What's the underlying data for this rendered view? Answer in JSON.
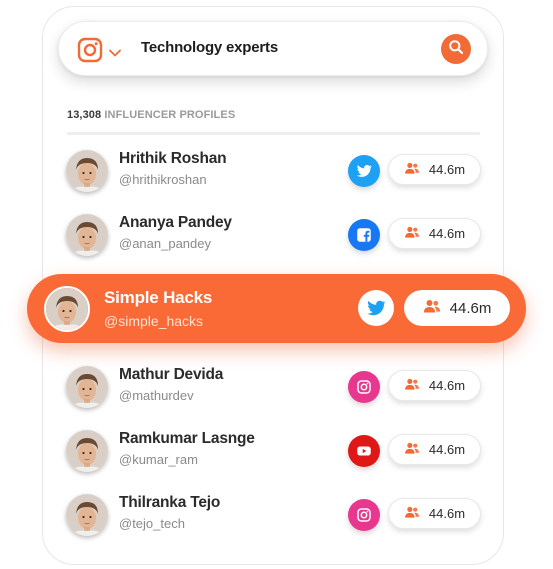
{
  "search": {
    "platform_icon": "instagram-icon",
    "query": "Technology experts",
    "button_icon": "search-icon"
  },
  "results": {
    "count": "13,308",
    "count_label": "INFLUENCER PROFILES"
  },
  "colors": {
    "accent": "#fa6a36",
    "twitter": "#1da1f2",
    "facebook": "#1877f2",
    "instagram": "#e8378f",
    "youtube": "#e01717"
  },
  "profiles": [
    {
      "name": "Hrithik Roshan",
      "handle": "@hrithikroshan",
      "platform": "twitter-icon",
      "followers": "44.6m"
    },
    {
      "name": "Ananya Pandey",
      "handle": "@anan_pandey",
      "platform": "facebook-icon",
      "followers": "44.6m"
    },
    {
      "name": "Simple Hacks",
      "handle": "@simple_hacks",
      "platform": "twitter-icon",
      "followers": "44.6m",
      "highlighted": true
    },
    {
      "name": "Mathur Devida",
      "handle": "@mathurdev",
      "platform": "instagram-icon",
      "followers": "44.6m"
    },
    {
      "name": "Ramkumar Lasnge",
      "handle": "@kumar_ram",
      "platform": "youtube-icon",
      "followers": "44.6m"
    },
    {
      "name": "Thilranka Tejo",
      "handle": "@tejo_tech",
      "platform": "instagram-icon",
      "followers": "44.6m"
    }
  ]
}
